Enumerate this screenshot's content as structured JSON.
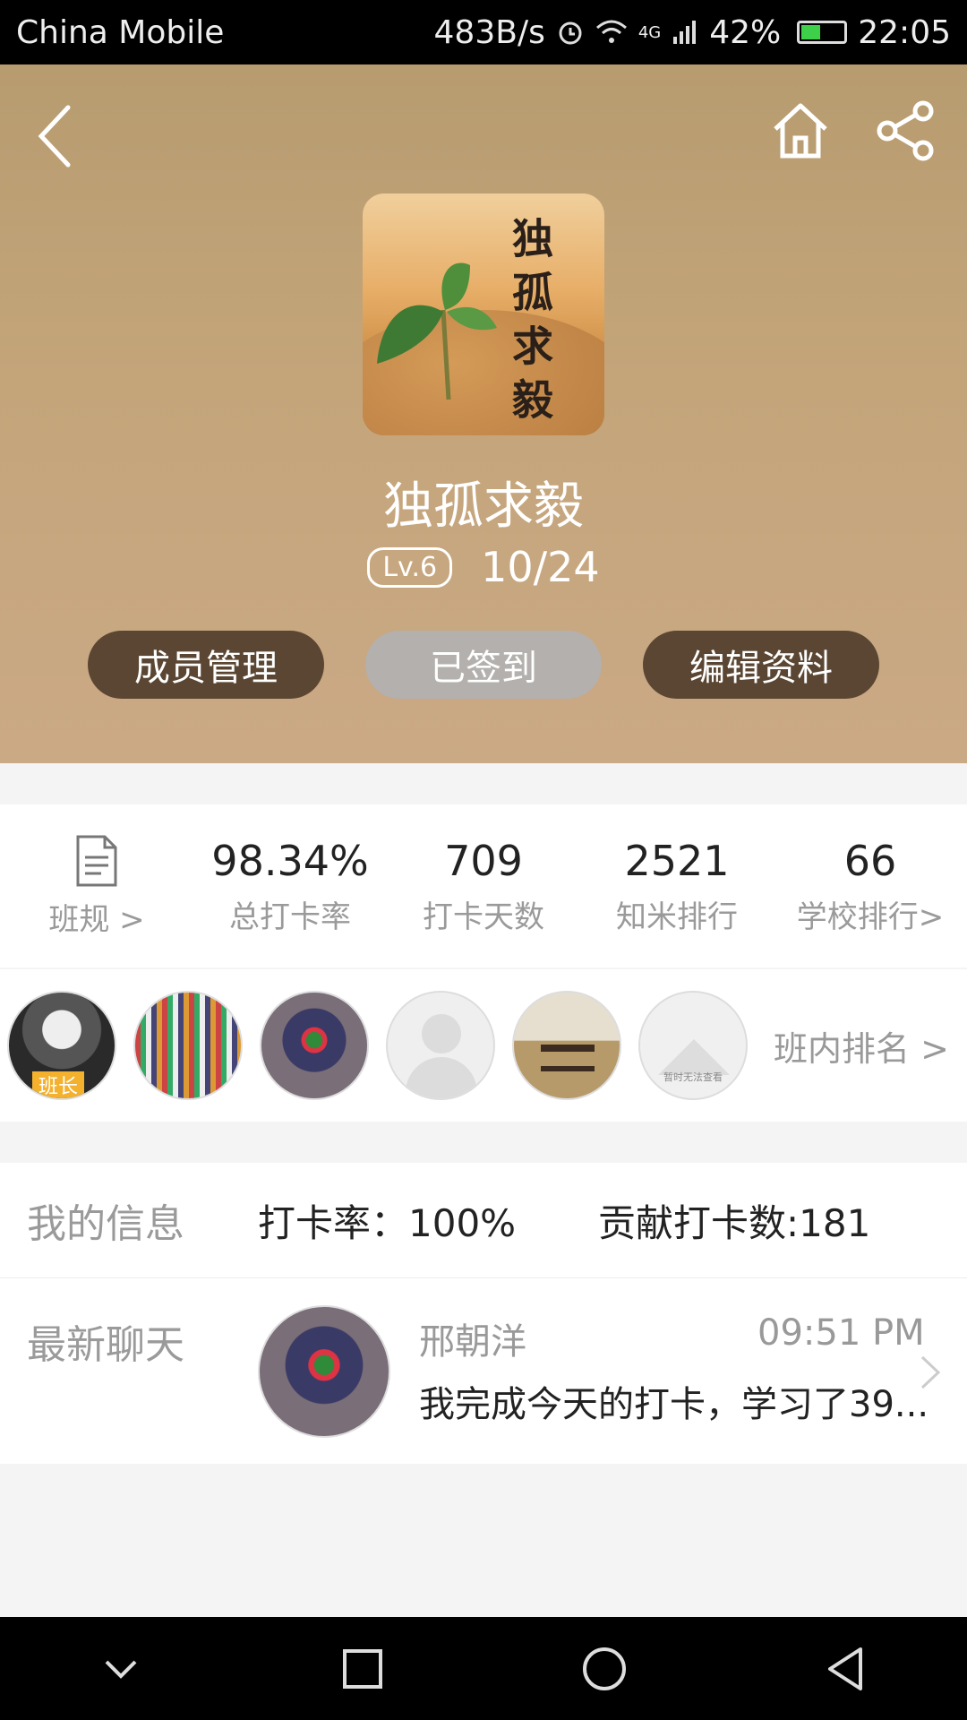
{
  "status_bar": {
    "carrier": "China Mobile",
    "speed": "483B/s",
    "network": "4G",
    "battery": "42%",
    "time": "22:05"
  },
  "group": {
    "cover_text": "独孤求毅",
    "title": "独孤求毅",
    "level": "Lv.6",
    "date": "10/24"
  },
  "actions": {
    "members_label": "成员管理",
    "checkin_label": "已签到",
    "edit_label": "编辑资料"
  },
  "stats": {
    "rules_label": "班规 >",
    "items": [
      {
        "value": "98.34%",
        "label": "总打卡率"
      },
      {
        "value": "709",
        "label": "打卡天数"
      },
      {
        "value": "2521",
        "label": "知米排行"
      },
      {
        "value": "66",
        "label": "学校排行>"
      }
    ]
  },
  "members": {
    "leader_badge": "班长",
    "placeholder_text": "暂时无法查看",
    "rank_label": "班内排名 >"
  },
  "my_info": {
    "section_label": "我的信息",
    "rate": "打卡率：100%",
    "contribution": "贡献打卡数:181"
  },
  "latest_chat": {
    "section_label": "最新聊天",
    "name": "邢朝洋",
    "time": "09:51 PM",
    "message": "我完成今天的打卡，学习了39..."
  },
  "colors": {
    "hero_gradient_top": "#b79c70",
    "button_dark": "#5a4632",
    "button_checked": "#b3b0ad",
    "badge_orange": "#f3b12e"
  }
}
